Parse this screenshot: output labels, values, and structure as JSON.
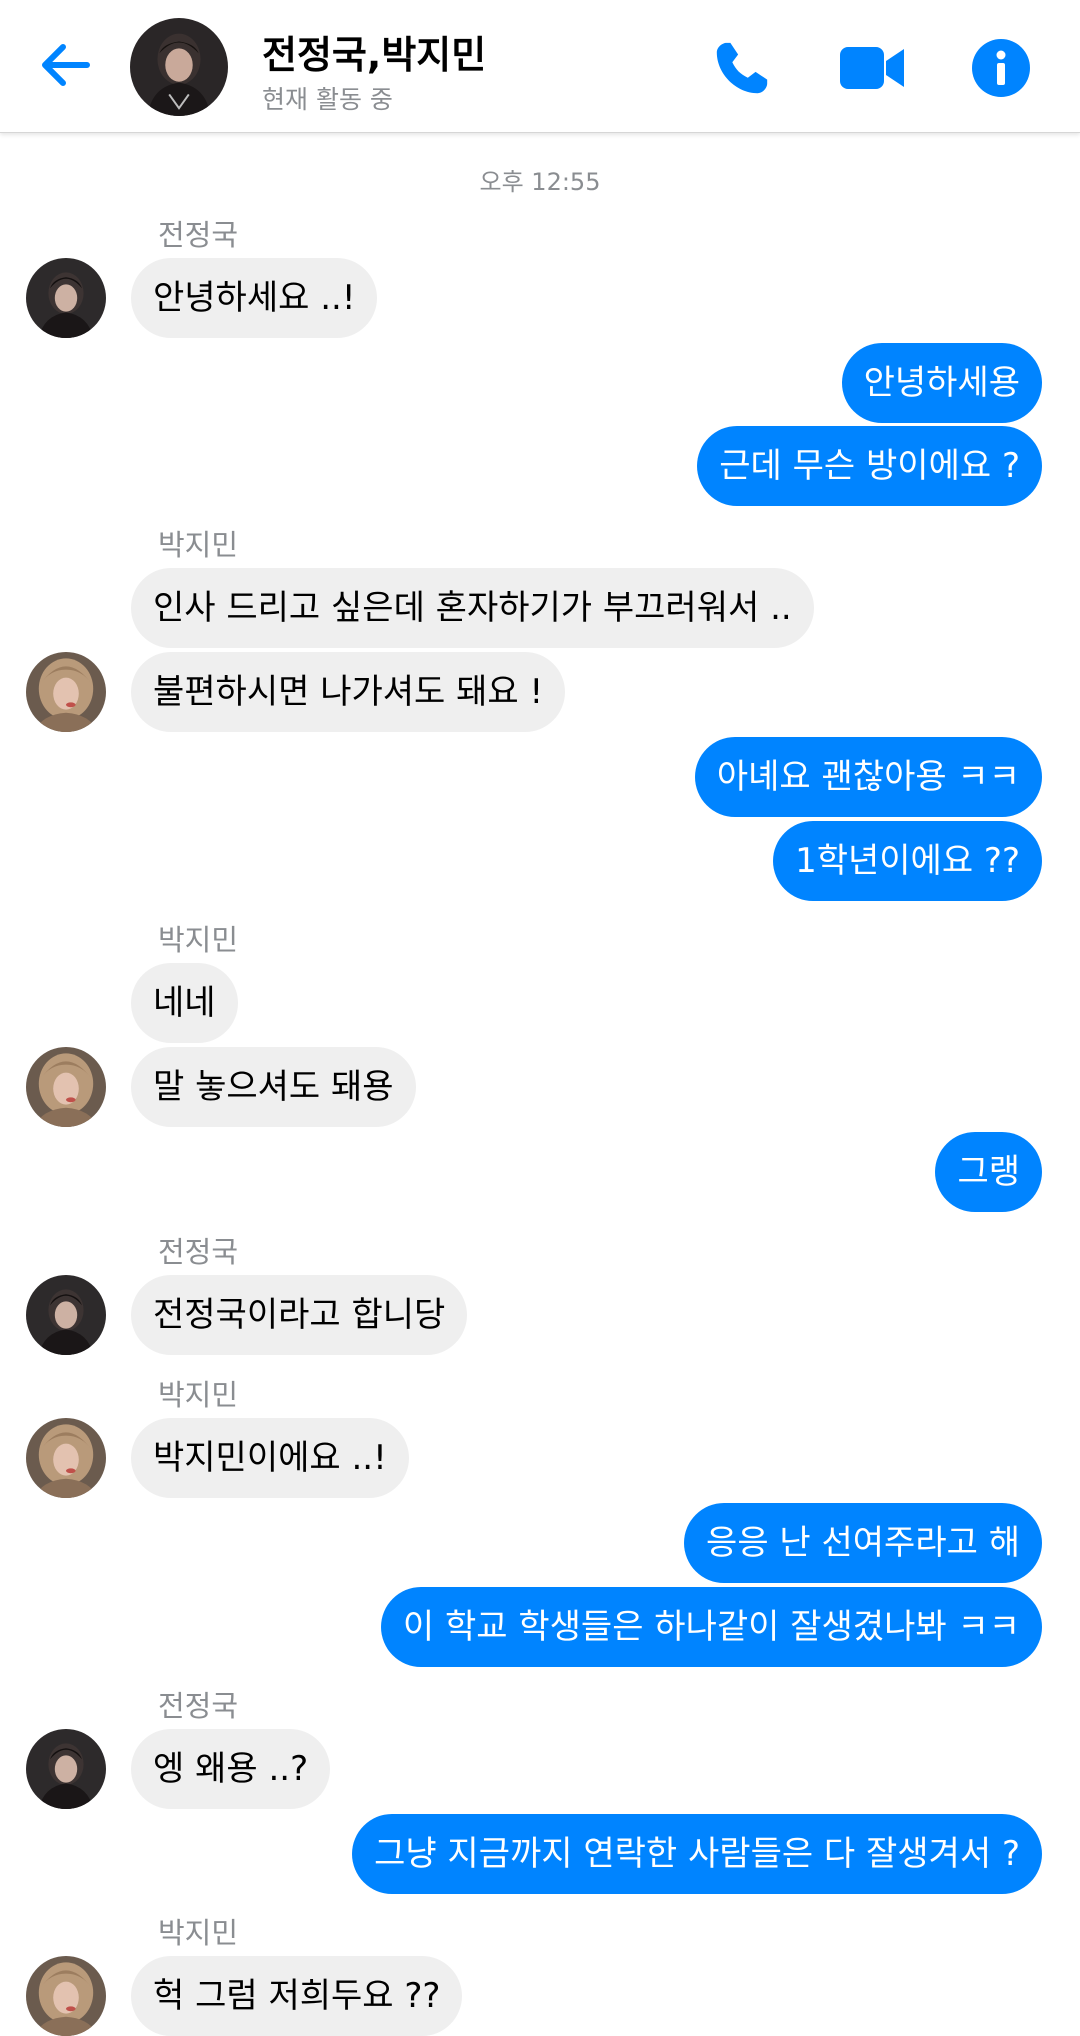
{
  "header": {
    "title": "전정국,박지민",
    "status": "현재 활동 중",
    "icons": {
      "back": "back-arrow-icon",
      "call": "phone-icon",
      "video": "video-camera-icon",
      "info": "info-icon"
    },
    "accent_color": "#0084ff"
  },
  "chat": {
    "timestamp": "오후 12:55",
    "senders": {
      "s1": "전정국",
      "s2": "박지민",
      "s3": "박지민",
      "s4": "전정국",
      "s5": "박지민",
      "s6": "전정국",
      "s7": "박지민"
    },
    "messages": {
      "m1": "안녕하세요 ..!",
      "m2": "안녕하세용",
      "m3": "근데 무슨 방이에요 ?",
      "m4": "인사 드리고 싶은데 혼자하기가 부끄러워서 ..",
      "m5": "불편하시면 나가셔도 돼요 !",
      "m6": "아녜요 괜찮아용 ㅋㅋ",
      "m7": "1학년이에요 ??",
      "m8": "네네",
      "m9": "말 놓으셔도 돼용",
      "m10": "그랭",
      "m11": "전정국이라고 합니당",
      "m12": "박지민이에요 ..!",
      "m13": "응응 난 선여주라고 해",
      "m14": "이 학교 학생들은 하나같이 잘생겼나봐 ㅋㅋ",
      "m15": "엥 왜용 ..?",
      "m16": "그냥 지금까지 연락한 사람들은 다 잘생겨서 ?",
      "m17": "헉 그럼 저희두요 ??"
    },
    "incoming_bubble_color": "#efefef",
    "outgoing_bubble_color": "#0084ff"
  }
}
